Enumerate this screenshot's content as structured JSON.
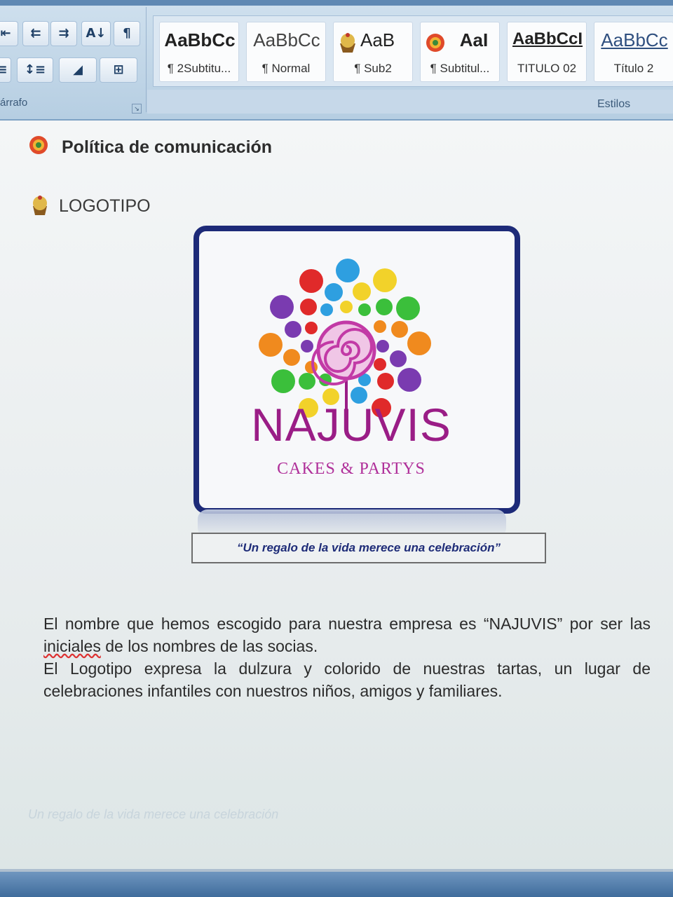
{
  "ribbon": {
    "paragraph_group_label": "árrafo",
    "styles_group_label": "Estilos",
    "paragraph_buttons": [
      {
        "icon": "indent-left-icon",
        "glyph": "⇤"
      },
      {
        "icon": "decrease-indent-icon",
        "glyph": "⇇"
      },
      {
        "icon": "increase-indent-icon",
        "glyph": "⇉"
      },
      {
        "icon": "sort-az-icon",
        "glyph": "A↓"
      },
      {
        "icon": "pilcrow-icon",
        "glyph": "¶"
      },
      {
        "icon": "justify-icon",
        "glyph": "≡"
      },
      {
        "icon": "line-spacing-icon",
        "glyph": "↕≡"
      },
      {
        "icon": "shading-icon",
        "glyph": "◢"
      },
      {
        "icon": "borders-icon",
        "glyph": "⊞"
      }
    ],
    "styles": [
      {
        "sample": "AaBbCc",
        "name": "¶ 2Subtitu..."
      },
      {
        "sample": "AaBbCc",
        "name": "¶ Normal"
      },
      {
        "sample": "AaB",
        "name": "¶ Sub2"
      },
      {
        "sample": "AaI",
        "name": "¶ Subtitul..."
      },
      {
        "sample": "AaBbCcI",
        "name": "TITULO 02"
      },
      {
        "sample": "AaBbCc",
        "name": "Título 2"
      }
    ]
  },
  "document": {
    "heading": "Política de comunicación",
    "subheading": "LOGOTIPO",
    "logo": {
      "brand": "NAJUVIS",
      "tagline_in_logo": "CAKES &  PARTYS",
      "colors": {
        "brand": "#9a1d86",
        "frame": "#1d2a78",
        "swirl": "#c23aa6"
      }
    },
    "tagline": "“Un regalo de la vida merece una celebración”",
    "paragraph1_a": "El nombre que hemos escogido para nuestra empresa es “NAJUVIS”  por ser las ",
    "paragraph1_misspelled": "iniciales",
    "paragraph1_b": " de los nombres de las socias.",
    "paragraph2": "El Logotipo expresa la  dulzura  y colorido de nuestras tartas,  un lugar de celebraciones infantiles  con nuestros niños, amigos y  familiares.",
    "ghost_text": "Un regalo de la vida merece una celebración"
  }
}
